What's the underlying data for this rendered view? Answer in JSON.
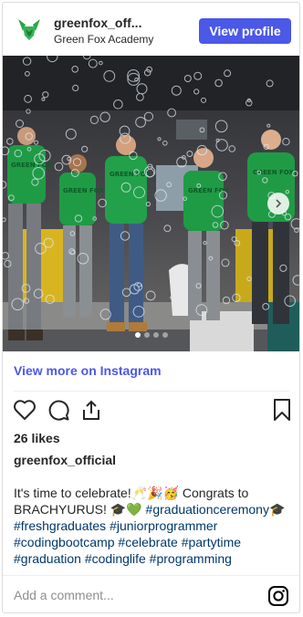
{
  "header": {
    "username": "greenfox_off...",
    "full_name": "Green Fox Academy",
    "view_profile_label": "View profile"
  },
  "photo": {
    "shirt_text": "GREEN FOX",
    "carousel_dots": 4,
    "active_dot": 1
  },
  "view_more_label": "View more on Instagram",
  "actions": {
    "icons": [
      "heart-icon",
      "comment-icon",
      "share-icon",
      "bookmark-icon"
    ]
  },
  "likes_text": "26 likes",
  "post": {
    "owner": "greenfox_official",
    "caption_text": "It's time to celebrate!🥂🎉🥳 Congrats to BRACHYURUS! 🎓💚 ",
    "hashtags": [
      "#graduationceremony",
      "🎓",
      "#freshgraduates",
      "#juniorprogrammer",
      "#codingbootcamp",
      "#celebrate",
      "#partytime",
      "#graduation",
      "#codinglife",
      "#programming"
    ]
  },
  "comment": {
    "placeholder": "Add a comment..."
  },
  "colors": {
    "accent": "#4b58e8",
    "hashtag": "#00376b",
    "brand_green": "#2aa44a"
  }
}
